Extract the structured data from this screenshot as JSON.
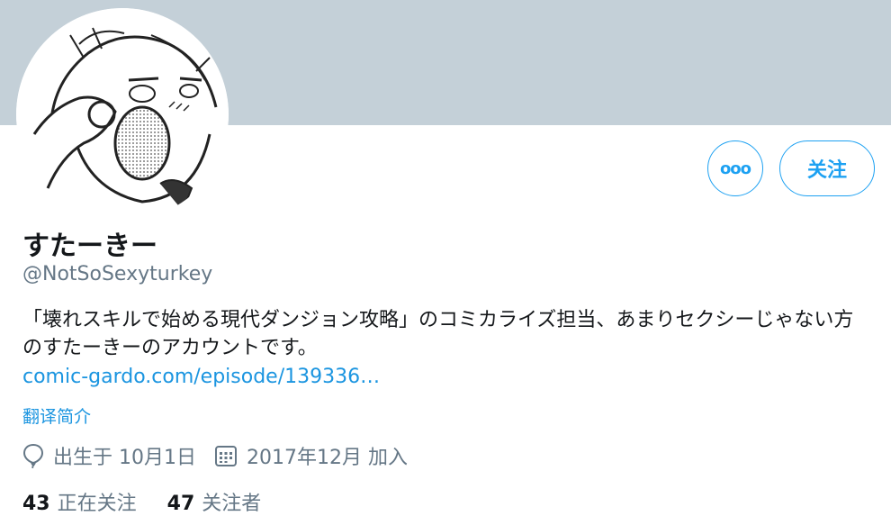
{
  "profile": {
    "display_name": "すたーきー",
    "handle": "@NotSoSexyturkey",
    "bio": "「壊れスキルで始める現代ダンジョン攻略」のコミカライズ担当、あまりセクシーじゃない方のすたーきーのアカウントです。",
    "link_text": "comic-gardo.com/episode/139336…",
    "translate_label": "翻译简介"
  },
  "actions": {
    "more_label": "ooo",
    "follow_label": "关注"
  },
  "meta": {
    "birthday": "出生于 10月1日",
    "joined": "2017年12月 加入"
  },
  "stats": {
    "following_count": "43",
    "following_label": "正在关注",
    "followers_count": "47",
    "followers_label": "关注者"
  },
  "colors": {
    "banner": "#c4d0d8",
    "accent": "#1da1f2",
    "link": "#1b95e0",
    "secondary_text": "#657786",
    "primary_text": "#14171a"
  },
  "icons": {
    "birthday": "balloon-icon",
    "joined": "calendar-icon",
    "more": "more-dots-icon"
  }
}
